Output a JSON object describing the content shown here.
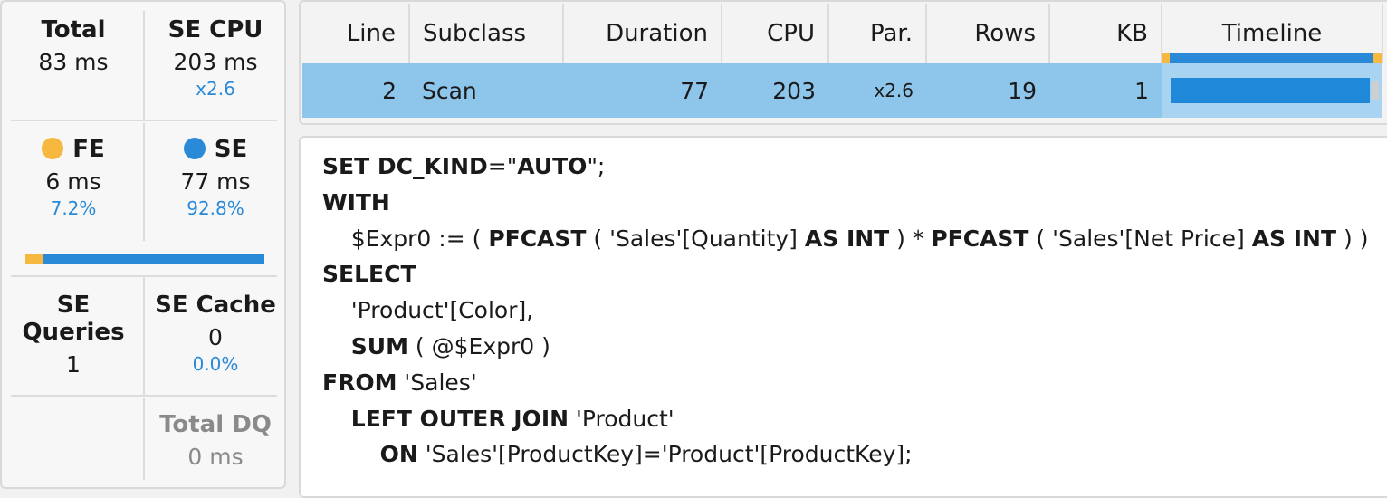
{
  "metrics": {
    "total": {
      "label": "Total",
      "value": "83 ms"
    },
    "se_cpu": {
      "label": "SE CPU",
      "value": "203 ms",
      "ratio": "x2.6"
    },
    "fe": {
      "label": "FE",
      "value": "6 ms",
      "percent": "7.2%"
    },
    "se": {
      "label": "SE",
      "value": "77 ms",
      "percent": "92.8%"
    },
    "split_bar": {
      "fe_fraction": 0.072,
      "se_fraction": 0.928
    },
    "se_queries": {
      "label": "SE Queries",
      "value": "1"
    },
    "se_cache": {
      "label": "SE Cache",
      "value": "0",
      "percent": "0.0%"
    },
    "total_dq": {
      "label": "Total DQ",
      "value": "0 ms"
    }
  },
  "colors": {
    "fe": "#f6b83e",
    "se": "#2a8ad8",
    "selected_row": "#8ec5ea",
    "percent_text": "#2a8ad8"
  },
  "grid": {
    "columns": [
      "Line",
      "Subclass",
      "Duration",
      "CPU",
      "Par.",
      "Rows",
      "KB",
      "Timeline"
    ],
    "rows": [
      {
        "line": "2",
        "subclass": "Scan",
        "duration": "77",
        "cpu": "203",
        "par": "x2.6",
        "rows": "19",
        "kb": "1"
      }
    ]
  },
  "query": {
    "lines": [
      [
        [
          "k",
          "SET DC_KIND"
        ],
        [
          "t",
          "=\""
        ],
        [
          "k",
          "AUTO"
        ],
        [
          "t",
          "\";"
        ]
      ],
      [
        [
          "k",
          "WITH"
        ]
      ],
      [
        [
          "t",
          "    $Expr0 := ( "
        ],
        [
          "k",
          "PFCAST"
        ],
        [
          "t",
          " ( 'Sales'[Quantity] "
        ],
        [
          "k",
          "AS INT"
        ],
        [
          "t",
          " ) * "
        ],
        [
          "k",
          "PFCAST"
        ],
        [
          "t",
          " ( 'Sales'[Net Price] "
        ],
        [
          "k",
          "AS INT"
        ],
        [
          "t",
          " ) )"
        ]
      ],
      [
        [
          "k",
          "SELECT"
        ]
      ],
      [
        [
          "t",
          "    'Product'[Color],"
        ]
      ],
      [
        [
          "t",
          "    "
        ],
        [
          "k",
          "SUM"
        ],
        [
          "t",
          " ( @$Expr0 )"
        ]
      ],
      [
        [
          "k",
          "FROM"
        ],
        [
          "t",
          " 'Sales'"
        ]
      ],
      [
        [
          "t",
          "    "
        ],
        [
          "k",
          "LEFT OUTER JOIN"
        ],
        [
          "t",
          " 'Product'"
        ]
      ],
      [
        [
          "t",
          "        "
        ],
        [
          "k",
          "ON"
        ],
        [
          "t",
          " 'Sales'[ProductKey]='Product'[ProductKey];"
        ]
      ]
    ]
  }
}
